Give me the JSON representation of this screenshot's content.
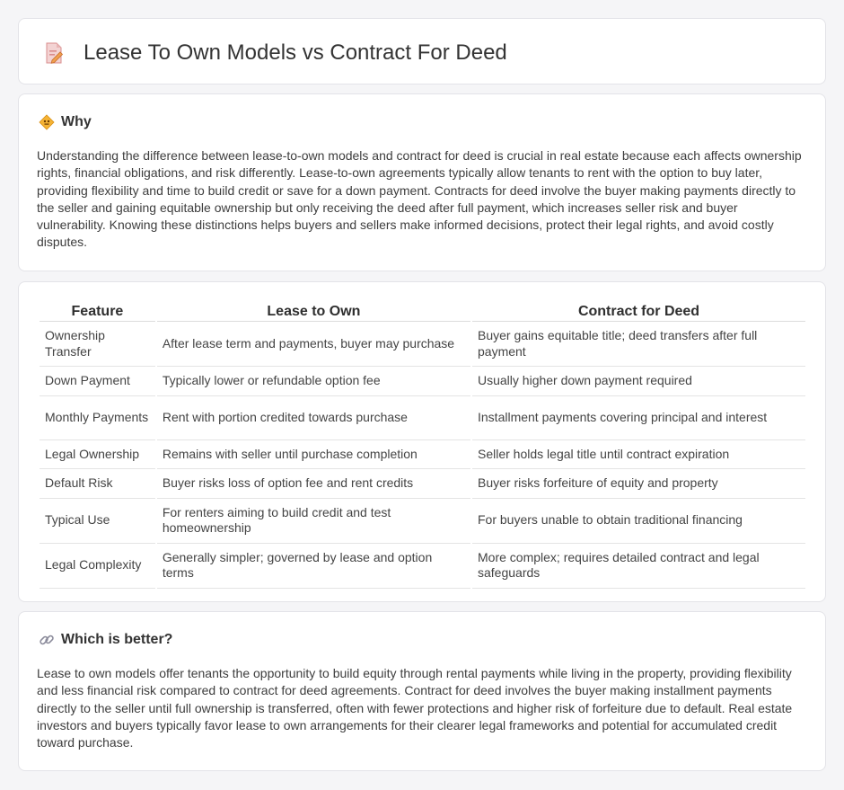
{
  "header": {
    "title": "Lease To Own Models vs Contract For Deed",
    "icon": "edit-document-icon"
  },
  "why": {
    "heading": "Why",
    "icon": "diamond-warning-icon",
    "body": "Understanding the difference between lease-to-own models and contract for deed is crucial in real estate because each affects ownership rights, financial obligations, and risk differently. Lease-to-own agreements typically allow tenants to rent with the option to buy later, providing flexibility and time to build credit or save for a down payment. Contracts for deed involve the buyer making payments directly to the seller and gaining equitable ownership but only receiving the deed after full payment, which increases seller risk and buyer vulnerability. Knowing these distinctions helps buyers and sellers make informed decisions, protect their legal rights, and avoid costly disputes."
  },
  "comparison": {
    "headers": [
      "Feature",
      "Lease to Own",
      "Contract for Deed"
    ],
    "rows": [
      [
        "Ownership Transfer",
        "After lease term and payments, buyer may purchase",
        "Buyer gains equitable title; deed transfers after full payment"
      ],
      [
        "Down Payment",
        "Typically lower or refundable option fee",
        "Usually higher down payment required"
      ],
      [
        "Monthly Payments",
        "Rent with portion credited towards purchase",
        "Installment payments covering principal and interest"
      ],
      [
        "Legal Ownership",
        "Remains with seller until purchase completion",
        "Seller holds legal title until contract expiration"
      ],
      [
        "Default Risk",
        "Buyer risks loss of option fee and rent credits",
        "Buyer risks forfeiture of equity and property"
      ],
      [
        "Typical Use",
        "For renters aiming to build credit and test homeownership",
        "For buyers unable to obtain traditional financing"
      ],
      [
        "Legal Complexity",
        "Generally simpler; governed by lease and option terms",
        "More complex; requires detailed contract and legal safeguards"
      ]
    ]
  },
  "better": {
    "heading": "Which is better?",
    "icon": "link-icon",
    "body": "Lease to own models offer tenants the opportunity to build equity through rental payments while living in the property, providing flexibility and less financial risk compared to contract for deed agreements. Contract for deed involves the buyer making installment payments directly to the seller until full ownership is transferred, often with fewer protections and higher risk of forfeiture due to default. Real estate investors and buyers typically favor lease to own arrangements for their clearer legal frameworks and potential for accumulated credit toward purchase."
  }
}
